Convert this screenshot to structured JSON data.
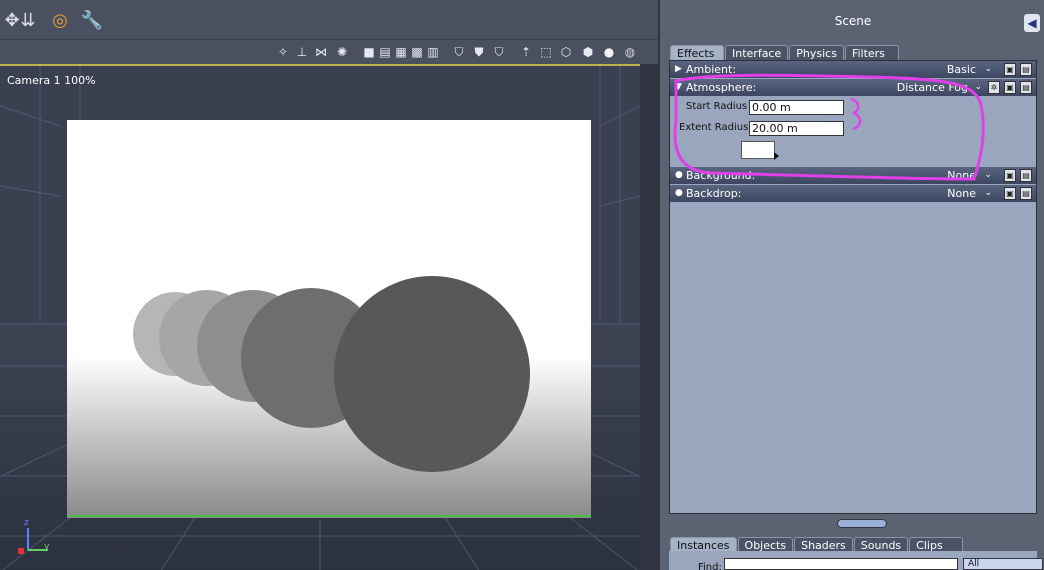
{
  "toolbar": {
    "tools": [
      {
        "name": "move-tool-icon",
        "glyph": "✥"
      },
      {
        "name": "scale-tool-icon",
        "glyph": "⇊"
      },
      {
        "name": "target-tool-icon",
        "glyph": "◎"
      },
      {
        "name": "wrench-tool-icon",
        "glyph": "🔧"
      }
    ],
    "view_buttons": [
      {
        "name": "light-icon",
        "glyph": "✧"
      },
      {
        "name": "pin-icon",
        "glyph": "⊥"
      },
      {
        "name": "spider-icon",
        "glyph": "⋈"
      },
      {
        "name": "gear-icon",
        "glyph": "✺"
      },
      {
        "name": "layout-single-icon",
        "glyph": "■"
      },
      {
        "name": "layout-two-icon",
        "glyph": "▤"
      },
      {
        "name": "layout-four-icon",
        "glyph": "▦"
      },
      {
        "name": "layout-grid-icon",
        "glyph": "▩"
      },
      {
        "name": "layout-split-icon",
        "glyph": "▥"
      },
      {
        "name": "shield-front-icon",
        "glyph": "⛉"
      },
      {
        "name": "shield-side-icon",
        "glyph": "⛊"
      },
      {
        "name": "shield-top-icon",
        "glyph": "⛉"
      },
      {
        "name": "arrow-up-icon",
        "glyph": "⇡"
      },
      {
        "name": "dashed-cube-icon",
        "glyph": "⬚"
      },
      {
        "name": "wire-cube-icon",
        "glyph": "⬡"
      },
      {
        "name": "solid-cube-icon",
        "glyph": "⬢"
      },
      {
        "name": "sphere-shaded-icon",
        "glyph": "●"
      },
      {
        "name": "sphere-metal-icon",
        "glyph": "◍"
      }
    ]
  },
  "viewport": {
    "camera_label": "Camera 1 100%",
    "axis_z": "z",
    "axis_y": "y"
  },
  "scene": {
    "title": "Scene",
    "back_glyph": "◀",
    "tabs": [
      "Effects",
      "Interface",
      "Physics",
      "Filters"
    ],
    "active_tab": "Effects",
    "rows": {
      "ambient": {
        "label": "Ambient:",
        "value": "Basic"
      },
      "atmosphere": {
        "label": "Atmosphere:",
        "value": "Distance Fog"
      },
      "background": {
        "label": "Background:",
        "value": "None"
      },
      "backdrop": {
        "label": "Backdrop:",
        "value": "None"
      }
    },
    "atmosphere_fields": {
      "start_radius_label": "Start Radius",
      "start_radius_value": "0.00 m",
      "extent_radius_label": "Extent Radius",
      "extent_radius_value": "20.00 m",
      "fog_color": "#ffffff"
    },
    "annotation_color": "#e040e8"
  },
  "lower": {
    "tabs": [
      "Instances",
      "Objects",
      "Shaders",
      "Sounds",
      "Clips"
    ],
    "active_tab": "Instances",
    "find_label": "Find:",
    "find_value": "",
    "filter_value": "All"
  },
  "colors": {
    "panel_bg": "#5b6272",
    "effects_bg": "#9aa6be",
    "row_header": "#3c4660",
    "viewport_bg": "#3a4050",
    "render_bg": "#ffffff",
    "sphere_fill": "#585858"
  }
}
